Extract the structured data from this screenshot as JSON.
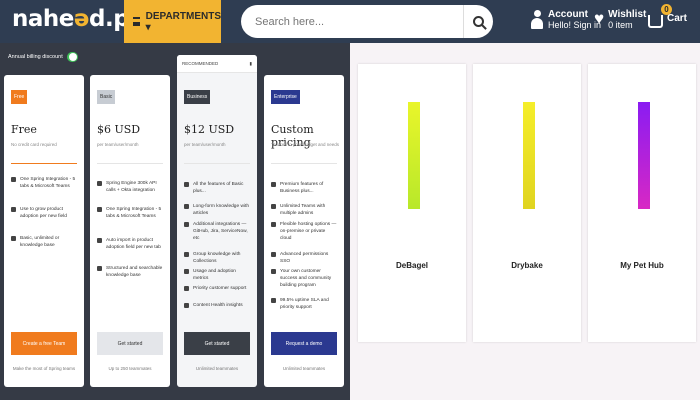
{
  "header": {
    "logo_main": "nahe",
    "logo_eye": "ə",
    "logo_rest": "d",
    "logo_tld": ".pk",
    "departments_label": "DEPARTMENTS ▾",
    "search_placeholder": "Search here...",
    "account_title": "Account",
    "account_sub": "Hello! Sign in",
    "wishlist_title": "Wishlist",
    "wishlist_sub": "0 item",
    "cart_label": "Cart",
    "cart_count": "0"
  },
  "billing": {
    "label": "Annual billing discount"
  },
  "plans": [
    {
      "badge": "Free",
      "badge_color": "#f07b1e",
      "price": "Free",
      "sub": "No credit card required",
      "features": [
        "One Spring Integration - 5 tabs & Microsoft Teams",
        "Use to grow product adoption per new field",
        "Basic, unlimited or knowledge base"
      ],
      "button": "Create a free Team",
      "button_color": "#f07b1e",
      "foot": "Make the most of Spring teams"
    },
    {
      "badge": "Basic",
      "badge_color": "#c7ccd3",
      "price": "$6 USD",
      "sub": "per team/user/month",
      "features": [
        "Spring Engine 300k API calls + Okta integration",
        "One Spring Integration - 5 tabs & Microsoft Teams",
        "Auto import in product adoption field per new tab",
        "Structured and searchable knowledge base"
      ],
      "button": "Get started",
      "button_color": "#e4e6ea",
      "foot": "Up to 250 teammates"
    },
    {
      "ribbon": "RECOMMENDED",
      "badge": "Business",
      "badge_color": "#3a3f47",
      "price": "$12 USD",
      "sub": "per team/user/month",
      "features": [
        "All the features of Basic plus...",
        "Long-form knowledge with articles",
        "Additional integrations — GitHub, Jira, ServiceNow, etc",
        "Group knowledge with Collections",
        "Usage and adoption metrics",
        "Priority customer support",
        "Content Health insights"
      ],
      "button": "Get started",
      "button_color": "#3a3f47",
      "foot": "Unlimited teammates"
    },
    {
      "badge": "Enterprise",
      "badge_color": "#2b3990",
      "price": "Custom pricing",
      "sub": "Tailored to your budget and needs",
      "features": [
        "Premium features of Business plus...",
        "Unlimited Teams with multiple admins",
        "Flexible hosting options — on-premise or private cloud",
        "Advanced permissions SSO",
        "Your own customer success and community building program",
        "99.5% uptime SLA and priority support"
      ],
      "button": "Request a demo",
      "button_color": "#2b3990",
      "foot": "Unlimited teammates"
    }
  ],
  "products": [
    {
      "name": "DeBagel",
      "color_top": "#e9f52a",
      "color_bottom": "#b8e82a"
    },
    {
      "name": "Drybake",
      "color_top": "#f5ee2a",
      "color_bottom": "#e0d420"
    },
    {
      "name": "My Pet Hub",
      "color_top": "#8a1cf2",
      "color_bottom": "#d828c4"
    }
  ]
}
